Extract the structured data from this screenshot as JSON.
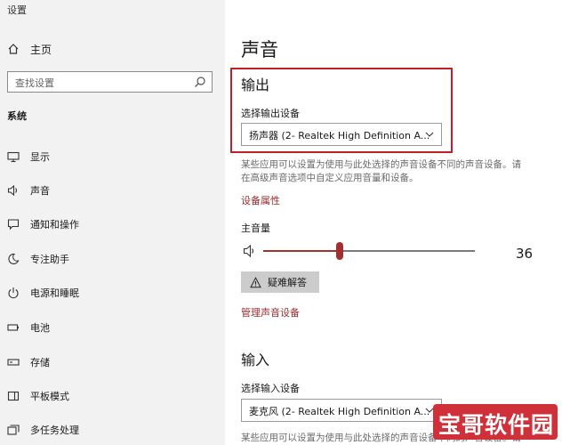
{
  "app": {
    "title": "设置"
  },
  "window_controls": {
    "minimize": "minimize-icon",
    "maximize": "maximize-icon",
    "close": "close-icon"
  },
  "sidebar": {
    "home_label": "主页",
    "search": {
      "placeholder": "查找设置"
    },
    "section_title": "系统",
    "items": [
      {
        "label": "显示",
        "icon": "monitor-icon"
      },
      {
        "label": "声音",
        "icon": "speaker-icon"
      },
      {
        "label": "通知和操作",
        "icon": "notification-icon"
      },
      {
        "label": "专注助手",
        "icon": "moon-icon"
      },
      {
        "label": "电源和睡眠",
        "icon": "power-icon"
      },
      {
        "label": "电池",
        "icon": "battery-icon"
      },
      {
        "label": "存储",
        "icon": "storage-icon"
      },
      {
        "label": "平板模式",
        "icon": "tablet-icon"
      },
      {
        "label": "多任务处理",
        "icon": "multitask-icon"
      }
    ]
  },
  "main": {
    "title": "声音",
    "output": {
      "heading": "输出",
      "select_label": "选择输出设备",
      "selected_device": "扬声器 (2- Realtek High Definition A...",
      "description_line1": "某些应用可以设置为使用与此处选择的声音设备不同的声音设备。请",
      "description_line2": "在高级声音选项中自定义应用音量和设备。",
      "device_properties_link": "设备属性",
      "master_volume_label": "主音量",
      "volume_value": "36",
      "volume_level": 0.36,
      "troubleshoot_label": "疑难解答",
      "manage_devices_link": "管理声音设备"
    },
    "input": {
      "heading": "输入",
      "select_label": "选择输入设备",
      "selected_device": "麦克风 (2- Realtek High Definition A...",
      "description_line1": "某些应用可以设置为使用与此处选择的声音设备不同的声音设备。请"
    }
  },
  "watermark": {
    "text": "宝哥软件园"
  },
  "colors": {
    "accent": "#a13030",
    "highlight_border": "#c0202a",
    "sidebar_bg": "#f2f2f2",
    "button_bg": "#cccccc",
    "watermark_bg": "#d0303a"
  }
}
